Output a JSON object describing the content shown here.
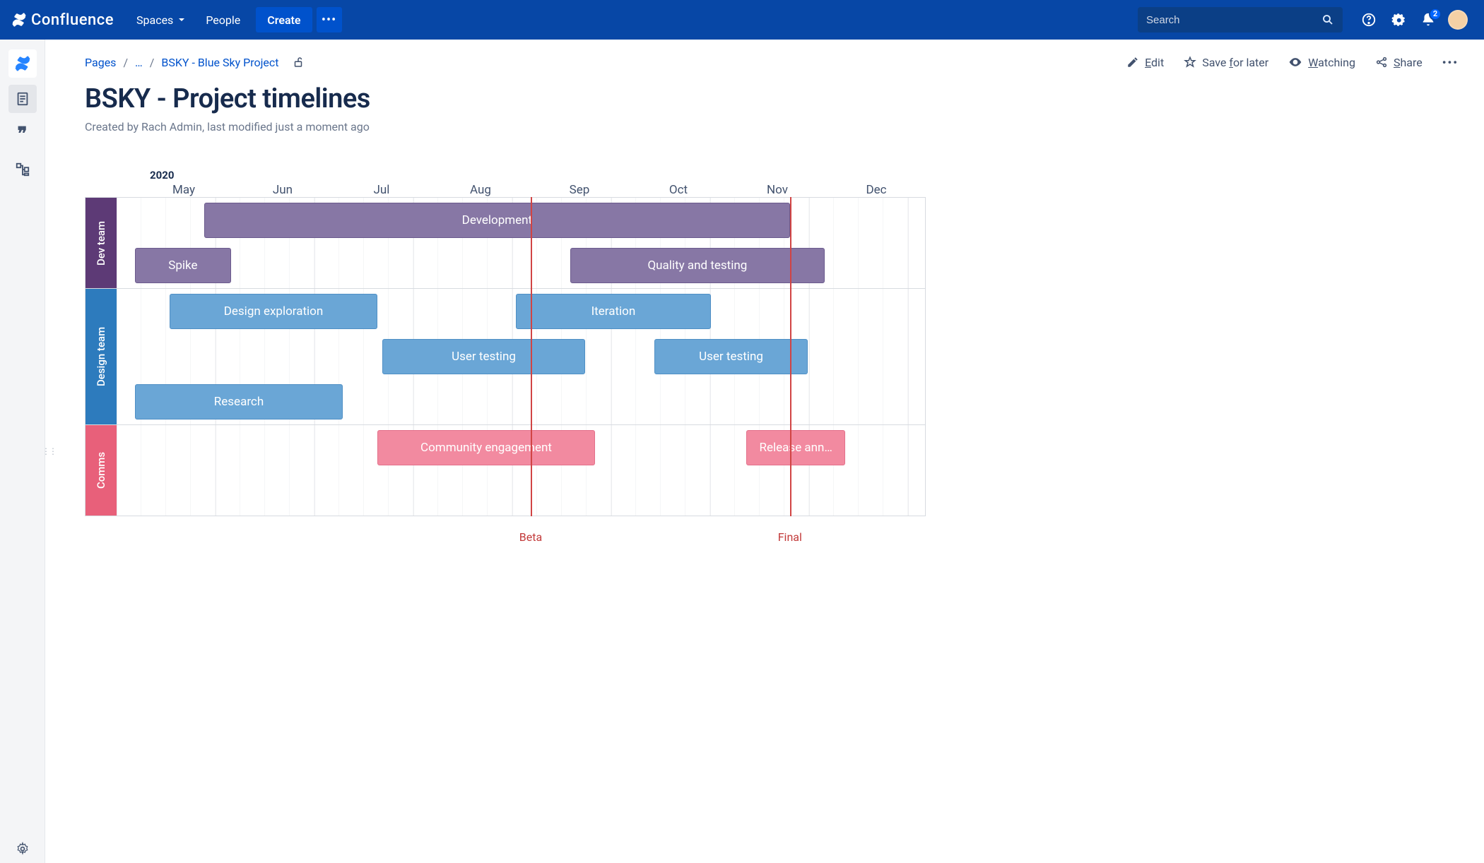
{
  "app": {
    "name": "Confluence"
  },
  "nav": {
    "spaces": "Spaces",
    "people": "People",
    "create": "Create",
    "search_placeholder": "Search",
    "notification_count": "2"
  },
  "breadcrumb": {
    "root": "Pages",
    "collapsed": "…",
    "parent": "BSKY - Blue Sky Project"
  },
  "actions": {
    "edit": "Edit",
    "save": "Save for later",
    "watching": "Watching",
    "share": "Share"
  },
  "page": {
    "title": "BSKY - Project timelines",
    "byline": "Created by Rach Admin, last modified just a moment ago"
  },
  "timeline": {
    "year": "2020",
    "months": [
      "May",
      "Jun",
      "Jul",
      "Aug",
      "Sep",
      "Oct",
      "Nov",
      "Dec"
    ],
    "milestones": [
      {
        "label": "Beta",
        "col": 4.0
      },
      {
        "label": "Final",
        "col": 6.62
      }
    ],
    "lanes": [
      {
        "name": "Dev team",
        "color": "dev",
        "rows": 2,
        "bars": [
          {
            "label": "Development",
            "row": 0,
            "start": 0.7,
            "span": 5.92,
            "tone": "purple"
          },
          {
            "label": "Spike",
            "row": 1,
            "start": 0.0,
            "span": 0.97,
            "tone": "purple"
          },
          {
            "label": "Quality and testing",
            "row": 1,
            "start": 4.4,
            "span": 2.57,
            "tone": "purple"
          }
        ]
      },
      {
        "name": "Design team",
        "color": "design",
        "rows": 3,
        "bars": [
          {
            "label": "Design exploration",
            "row": 0,
            "start": 0.35,
            "span": 2.1,
            "tone": "blue"
          },
          {
            "label": "Iteration",
            "row": 0,
            "start": 3.85,
            "span": 1.97,
            "tone": "blue"
          },
          {
            "label": "User testing",
            "row": 1,
            "start": 2.5,
            "span": 2.05,
            "tone": "blue"
          },
          {
            "label": "User testing",
            "row": 1,
            "start": 5.25,
            "span": 1.55,
            "tone": "blue"
          },
          {
            "label": "Research",
            "row": 2,
            "start": 0.0,
            "span": 2.1,
            "tone": "blue"
          }
        ]
      },
      {
        "name": "Comms",
        "color": "comms",
        "rows": 2,
        "bars": [
          {
            "label": "Community engagement",
            "row": 0,
            "start": 2.45,
            "span": 2.2,
            "tone": "pink"
          },
          {
            "label": "Release ann…",
            "row": 0,
            "start": 6.18,
            "span": 1.0,
            "tone": "pink"
          }
        ]
      }
    ]
  },
  "chart_data": {
    "type": "gantt",
    "title": "BSKY - Project timelines",
    "year": 2020,
    "x_categories": [
      "May",
      "Jun",
      "Jul",
      "Aug",
      "Sep",
      "Oct",
      "Nov",
      "Dec"
    ],
    "lanes": [
      {
        "name": "Dev team",
        "tasks": [
          {
            "name": "Development",
            "start": "2020-05-22",
            "end": "2020-11-20"
          },
          {
            "name": "Spike",
            "start": "2020-05-01",
            "end": "2020-05-31"
          },
          {
            "name": "Quality and testing",
            "start": "2020-09-13",
            "end": "2020-11-30"
          }
        ]
      },
      {
        "name": "Design team",
        "tasks": [
          {
            "name": "Design exploration",
            "start": "2020-05-12",
            "end": "2020-07-15"
          },
          {
            "name": "Iteration",
            "start": "2020-08-26",
            "end": "2020-10-26"
          },
          {
            "name": "User testing",
            "start": "2020-07-16",
            "end": "2020-09-17"
          },
          {
            "name": "User testing",
            "start": "2020-10-08",
            "end": "2020-11-24"
          },
          {
            "name": "Research",
            "start": "2020-05-01",
            "end": "2020-07-04"
          }
        ]
      },
      {
        "name": "Comms",
        "tasks": [
          {
            "name": "Community engagement",
            "start": "2020-07-14",
            "end": "2020-09-20"
          },
          {
            "name": "Release announcement",
            "start": "2020-11-06",
            "end": "2020-12-06"
          }
        ]
      }
    ],
    "milestones": [
      {
        "name": "Beta",
        "date": "2020-09-01"
      },
      {
        "name": "Final",
        "date": "2020-11-20"
      }
    ]
  }
}
